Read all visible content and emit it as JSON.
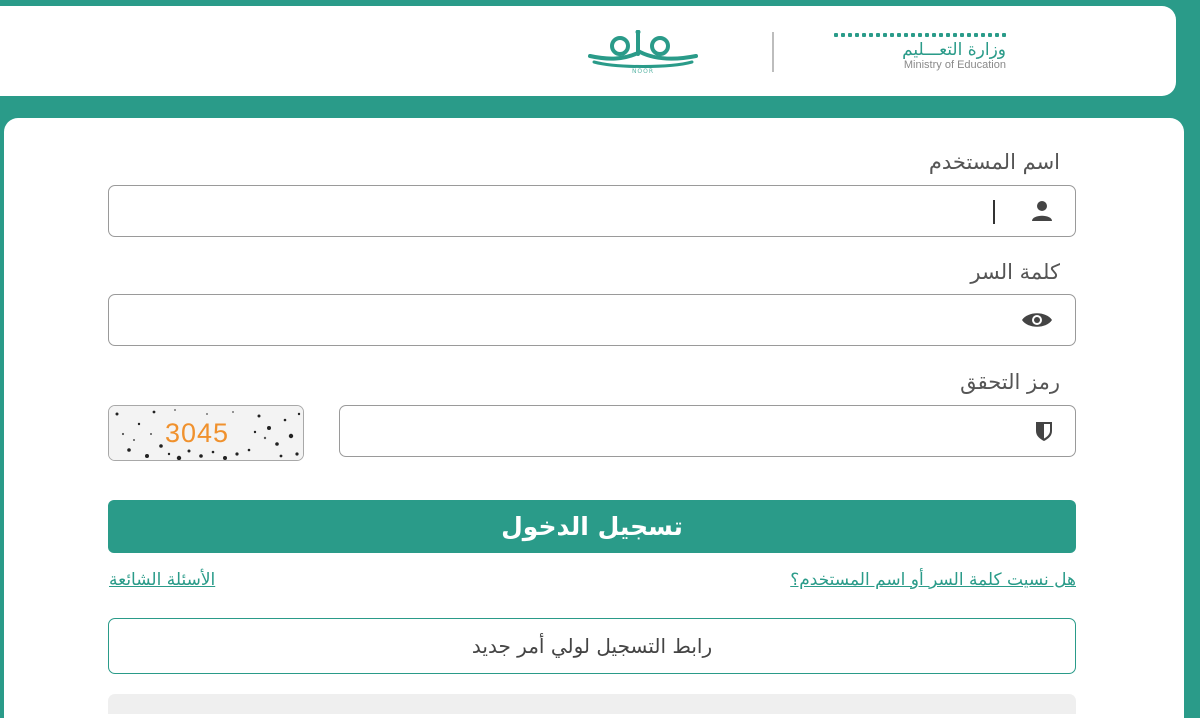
{
  "header": {
    "noor_logo_text": "NOOR",
    "ministry_name_ar": "وزارة التعـــليم",
    "ministry_name_en": "Ministry of Education"
  },
  "form": {
    "username": {
      "label": "اسم المستخدم",
      "value": "",
      "placeholder": ""
    },
    "password": {
      "label": "كلمة السر",
      "value": "",
      "placeholder": ""
    },
    "captcha": {
      "label": "رمز التحقق",
      "value": "",
      "placeholder": "",
      "image_code": "3045"
    },
    "login_button": "تسجيل الدخول",
    "forgot_link": "هل نسيت كلمة السر أو اسم المستخدم؟",
    "faq_link": "الأسئلة الشائعة",
    "register_button": "رابط التسجيل لولي أمر جديد"
  },
  "colors": {
    "brand": "#2a9b89",
    "captcha_digits": "#f0912d"
  },
  "icons": {
    "username": "user-icon",
    "password": "eye-icon",
    "captcha": "shield-icon"
  }
}
